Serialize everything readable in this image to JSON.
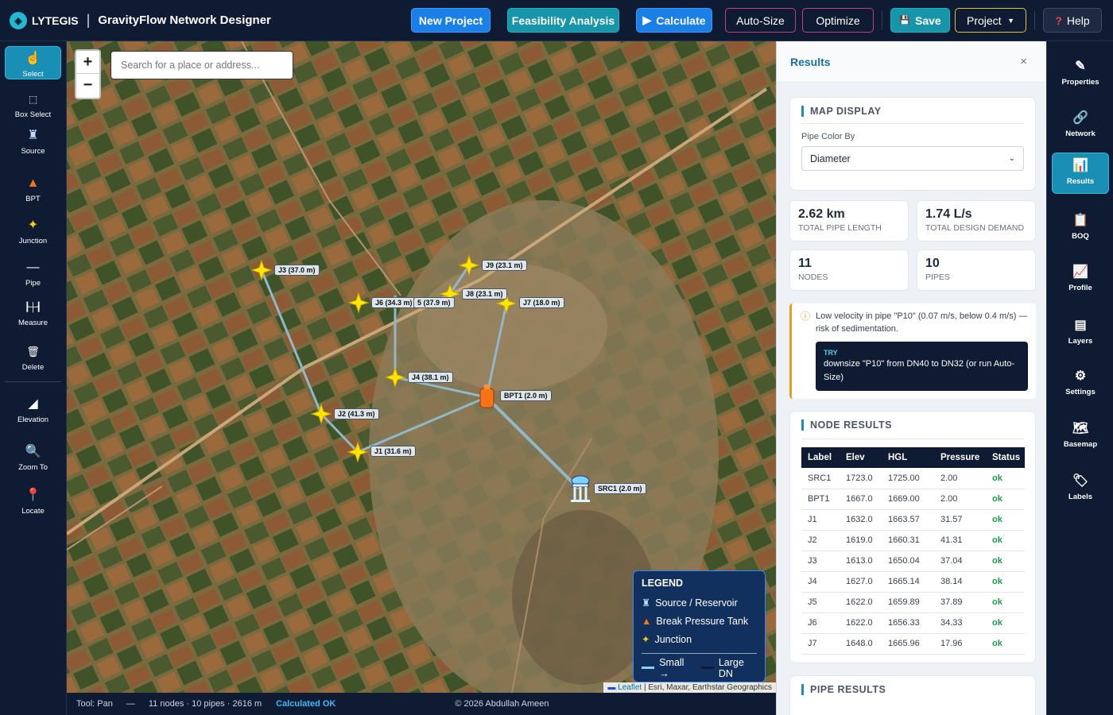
{
  "app": {
    "logo_text": "LYTEGIS",
    "title": "GravityFlow Network Designer"
  },
  "toolbar": {
    "new_project": "New Project",
    "feasibility": "Feasibility Analysis",
    "calculate": "Calculate",
    "auto_size": "Auto-Size",
    "optimize": "Optimize",
    "save": "Save",
    "project": "Project",
    "help": "Help"
  },
  "left_tools": [
    {
      "label": "Select",
      "icon": "hand-pointer-icon"
    },
    {
      "label": "Box Select",
      "icon": "dashed-square-icon"
    },
    {
      "label": "Source",
      "icon": "water-tower-icon"
    },
    {
      "label": "BPT",
      "icon": "tank-icon"
    },
    {
      "label": "Junction",
      "icon": "star-icon"
    },
    {
      "label": "Pipe",
      "icon": "line-icon"
    },
    {
      "label": "Measure",
      "icon": "ruler-icon"
    },
    {
      "label": "Delete",
      "icon": "trash-icon"
    },
    {
      "label": "Elevation",
      "icon": "elevation-icon"
    },
    {
      "label": "Zoom To",
      "icon": "magnifier-icon"
    },
    {
      "label": "Locate",
      "icon": "pin-icon"
    }
  ],
  "map": {
    "search_placeholder": "Search for a place or address...",
    "zoom_in": "+",
    "zoom_out": "−",
    "node_labels": {
      "J3": "J3 (37.0 m)",
      "J9": "J9 (23.1 m)",
      "J6": "J6 (34.3 m)",
      "J5": "5 (37.9 m)",
      "J8": "J8 (23.1 m)",
      "J7": "J7 (18.0 m)",
      "J4": "J4 (38.1 m)",
      "BPT1": "BPT1 (2.0 m)",
      "J2": "J2 (41.3 m)",
      "J1": "J1 (31.6 m)",
      "SRC1": "SRC1 (2.0 m)"
    },
    "legend": {
      "title": "LEGEND",
      "source": "Source / Reservoir",
      "bpt": "Break Pressure Tank",
      "junction": "Junction",
      "small": "Small →",
      "large": "Large DN"
    },
    "attribution": {
      "leaflet": "Leaflet",
      "rest": "| Esri, Maxar, Earthstar Geographics"
    }
  },
  "status": {
    "tool": "Tool: Pan",
    "dash": "—",
    "summary": "11 nodes · 10 pipes · 2616 m",
    "calc": "Calculated OK",
    "copyright": "© 2026 Abdullah Ameen"
  },
  "results": {
    "title": "Results",
    "close": "×",
    "map_display": {
      "title": "MAP DISPLAY",
      "label": "Pipe Color By",
      "selected": "Diameter"
    },
    "stats": [
      {
        "value": "2.62 km",
        "label": "TOTAL PIPE LENGTH"
      },
      {
        "value": "1.74 L/s",
        "label": "TOTAL DESIGN DEMAND"
      },
      {
        "value": "11",
        "label": "NODES"
      },
      {
        "value": "10",
        "label": "PIPES"
      }
    ],
    "warning": {
      "text": "Low velocity in pipe \"P10\" (0.07 m/s, below 0.4 m/s) — risk of sedimentation.",
      "try_label": "TRY",
      "try_text": "downsize \"P10\" from DN40 to DN32 (or run Auto-Size)"
    },
    "node_results": {
      "title": "NODE RESULTS",
      "headers": [
        "Label",
        "Elev",
        "HGL",
        "Pressure",
        "Status"
      ],
      "rows": [
        [
          "SRC1",
          "1723.0",
          "1725.00",
          "2.00",
          "ok"
        ],
        [
          "BPT1",
          "1667.0",
          "1669.00",
          "2.00",
          "ok"
        ],
        [
          "J1",
          "1632.0",
          "1663.57",
          "31.57",
          "ok"
        ],
        [
          "J2",
          "1619.0",
          "1660.31",
          "41.31",
          "ok"
        ],
        [
          "J3",
          "1613.0",
          "1650.04",
          "37.04",
          "ok"
        ],
        [
          "J4",
          "1627.0",
          "1665.14",
          "38.14",
          "ok"
        ],
        [
          "J5",
          "1622.0",
          "1659.89",
          "37.89",
          "ok"
        ],
        [
          "J6",
          "1622.0",
          "1656.33",
          "34.33",
          "ok"
        ],
        [
          "J7",
          "1648.0",
          "1665.96",
          "17.96",
          "ok"
        ]
      ]
    },
    "pipe_results": {
      "title": "PIPE RESULTS"
    }
  },
  "right_tools": [
    {
      "label": "Properties",
      "icon": "pencil-icon"
    },
    {
      "label": "Network",
      "icon": "link-icon"
    },
    {
      "label": "Results",
      "icon": "bar-chart-icon"
    },
    {
      "label": "BOQ",
      "icon": "clipboard-icon"
    },
    {
      "label": "Profile",
      "icon": "line-chart-icon"
    },
    {
      "label": "Layers",
      "icon": "layers-icon"
    },
    {
      "label": "Settings",
      "icon": "gear-icon"
    },
    {
      "label": "Basemap",
      "icon": "map-stack-icon"
    },
    {
      "label": "Labels",
      "icon": "tag-icon"
    }
  ]
}
